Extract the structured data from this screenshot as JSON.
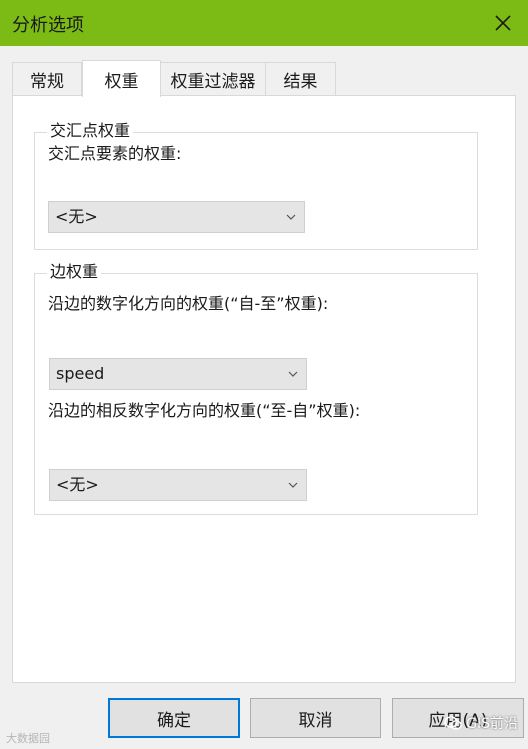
{
  "window": {
    "title": "分析选项"
  },
  "tabs": [
    {
      "label": "常规"
    },
    {
      "label": "权重"
    },
    {
      "label": "权重过滤器"
    },
    {
      "label": "结果"
    }
  ],
  "junction_weight": {
    "group_title": "交汇点权重",
    "field_label": "交汇点要素的权重:",
    "value": "<无>"
  },
  "edge_weight": {
    "group_title": "边权重",
    "from_to_label": "沿边的数字化方向的权重(“自-至”权重):",
    "from_to_value": "speed",
    "to_from_label": "沿边的相反数字化方向的权重(“至-自”权重):",
    "to_from_value": "<无>"
  },
  "buttons": {
    "ok": "确定",
    "cancel": "取消",
    "apply": "应用(A)"
  },
  "watermarks": {
    "left": "大数据园",
    "right": "GIS前沿"
  },
  "colors": {
    "titlebar": "#7cbb16",
    "focus": "#0078d7"
  }
}
